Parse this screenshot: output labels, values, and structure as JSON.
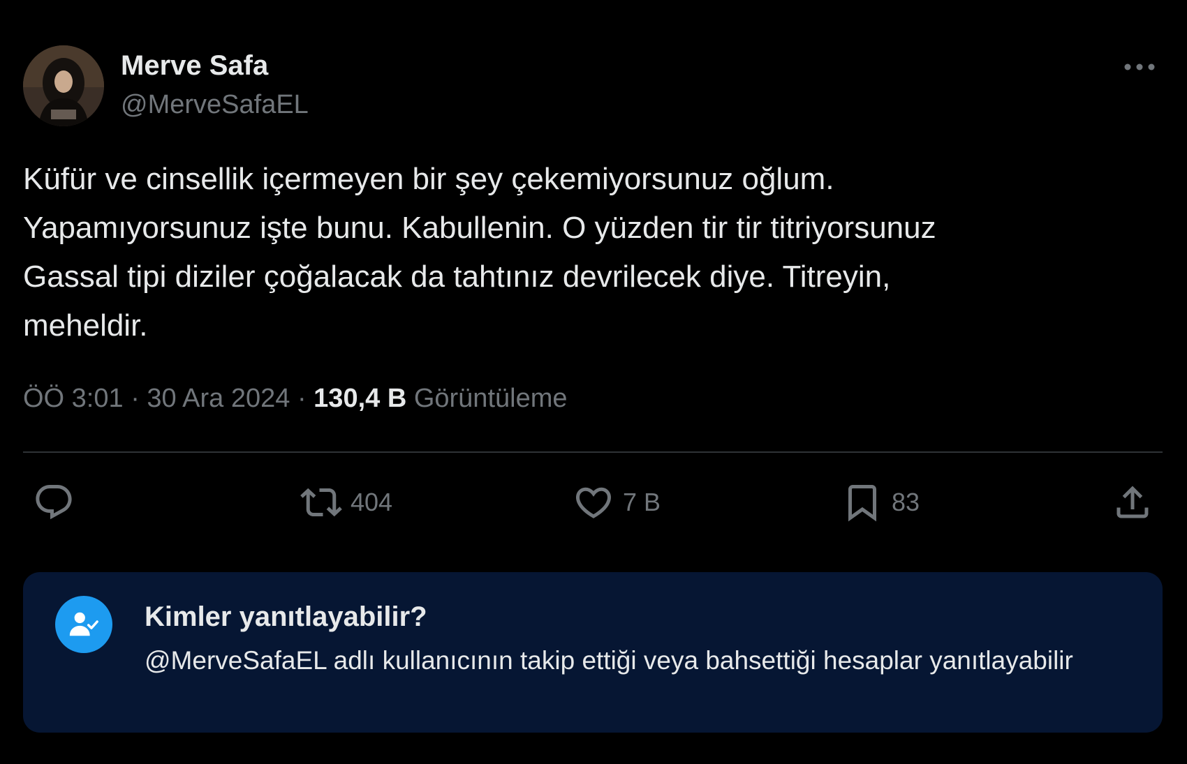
{
  "author": {
    "display_name": "Merve Safa",
    "handle": "@MerveSafaEL"
  },
  "tweet": {
    "text": "Küfür ve cinsellik içermeyen bir şey çekemiyorsunuz oğlum.\nYapamıyorsunuz işte bunu. Kabullenin. O yüzden tir tir titriyorsunuz\nGassal tipi diziler çoğalacak da tahtınız devrilecek diye. Titreyin,\nmeheldir.",
    "time": "ÖÖ 3:01",
    "date": "30 Ara 2024",
    "views_count": "130,4 B",
    "views_label": "Görüntüleme"
  },
  "actions": {
    "reply_icon": "speech-bubble-icon",
    "retweet_icon": "retweet-icon",
    "retweet_count": "404",
    "like_icon": "heart-icon",
    "like_count": "7 B",
    "bookmark_icon": "bookmark-icon",
    "bookmark_count": "83",
    "share_icon": "share-upload-icon"
  },
  "reply_restriction": {
    "title": "Kimler yanıtlayabilir?",
    "description": "@MerveSafaEL adlı kullanıcının takip ettiği veya bahsettiği hesaplar yanıtlayabilir",
    "icon": "user-check-icon"
  },
  "colors": {
    "background": "#000000",
    "text_primary": "#e7e9ea",
    "text_secondary": "#71767b",
    "divider": "#2f3336",
    "reply_box_bg": "#061633",
    "accent": "#1d9bf0"
  }
}
